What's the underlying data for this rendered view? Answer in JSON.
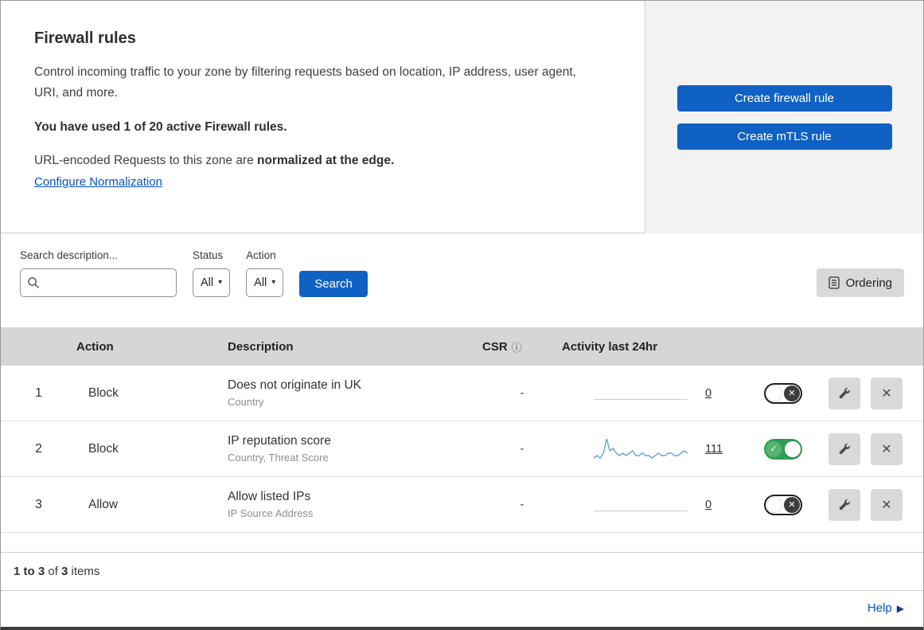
{
  "colors": {
    "primary_blue": "#1061c4",
    "link_blue": "#0051c3",
    "toggle_on_green": "#2f9e55",
    "sparkline_blue": "#6b9fd4"
  },
  "icons": {
    "dropdown_caret": "▾",
    "info": "ⓘ",
    "check": "✓",
    "cross": "✕",
    "close": "✕",
    "help_arrow": "▶"
  },
  "header": {
    "title": "Firewall rules",
    "description": "Control incoming traffic to your zone by filtering requests based on location, IP address, user agent, URI, and more.",
    "usage": "You have used 1 of 20 active Firewall rules.",
    "normalization_prefix": "URL-encoded Requests to this zone are ",
    "normalization_bold": "normalized at the edge.",
    "normalization_link": "Configure Normalization",
    "buttons": {
      "create_firewall": "Create firewall rule",
      "create_mtls": "Create mTLS rule"
    }
  },
  "filters": {
    "search_label": "Search description...",
    "status_label": "Status",
    "status_value": "All",
    "action_label": "Action",
    "action_value": "All",
    "search_button": "Search",
    "ordering_button": "Ordering"
  },
  "table": {
    "columns": {
      "action": "Action",
      "description": "Description",
      "csr": "CSR",
      "activity": "Activity last 24hr"
    },
    "rows": [
      {
        "index": "1",
        "action": "Block",
        "description": "Does not originate in UK",
        "fields": "Country",
        "csr": "-",
        "activity_count": "0",
        "enabled": false,
        "sparkline": null
      },
      {
        "index": "2",
        "action": "Block",
        "description": "IP reputation score",
        "fields": "Country, Threat Score",
        "csr": "-",
        "activity_count": "111",
        "enabled": true,
        "sparkline": [
          1,
          2,
          1,
          3,
          9,
          4,
          5,
          3,
          2,
          3,
          2,
          3,
          4,
          2,
          2,
          3,
          2,
          2,
          1,
          2,
          3,
          2,
          2,
          3,
          3,
          2,
          2,
          3,
          4,
          3
        ]
      },
      {
        "index": "3",
        "action": "Allow",
        "description": "Allow listed IPs",
        "fields": "IP Source Address",
        "csr": "-",
        "activity_count": "0",
        "enabled": false,
        "sparkline": null
      }
    ]
  },
  "footer": {
    "range": "1 to 3",
    "of_text": " of ",
    "total": "3",
    "items_text": " items",
    "help": "Help"
  }
}
